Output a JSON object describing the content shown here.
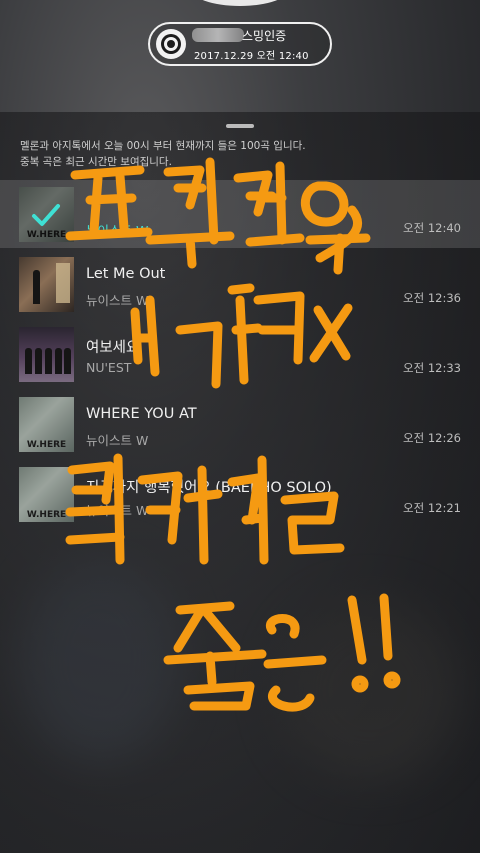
{
  "auth_badge": {
    "title": "스밍인증",
    "date": "2017.12.29 오전 12:40"
  },
  "info_text": {
    "line1": "멜론과 아지톡에서 오늘 00시 부터 현재까지 들은 100곡 입니다.",
    "line2": "중복 곡은 최근 시간만 보여집니다."
  },
  "songs": [
    {
      "title": "",
      "artist": "뉴이스트 W",
      "time": "오전 12:40",
      "selected": true,
      "art_text": "W.HERE"
    },
    {
      "title": "Let Me Out",
      "artist": "뉴이스트 W",
      "time": "오전 12:36",
      "selected": false
    },
    {
      "title": "여보세요",
      "artist": "NU'EST",
      "time": "오전 12:33",
      "selected": false
    },
    {
      "title": "WHERE YOU AT",
      "artist": "뉴이스트 W",
      "time": "오전 12:26",
      "selected": false,
      "art_text": "W.HERE"
    },
    {
      "title": "지금까지 행복했어요 (BAEKHO SOLO)",
      "artist": "뉴이스트 W",
      "time": "오전 12:21",
      "selected": false,
      "art_text": "W.HERE"
    }
  ],
  "colors": {
    "accent": "#3fe0d4",
    "graffiti": "#f59a12"
  }
}
